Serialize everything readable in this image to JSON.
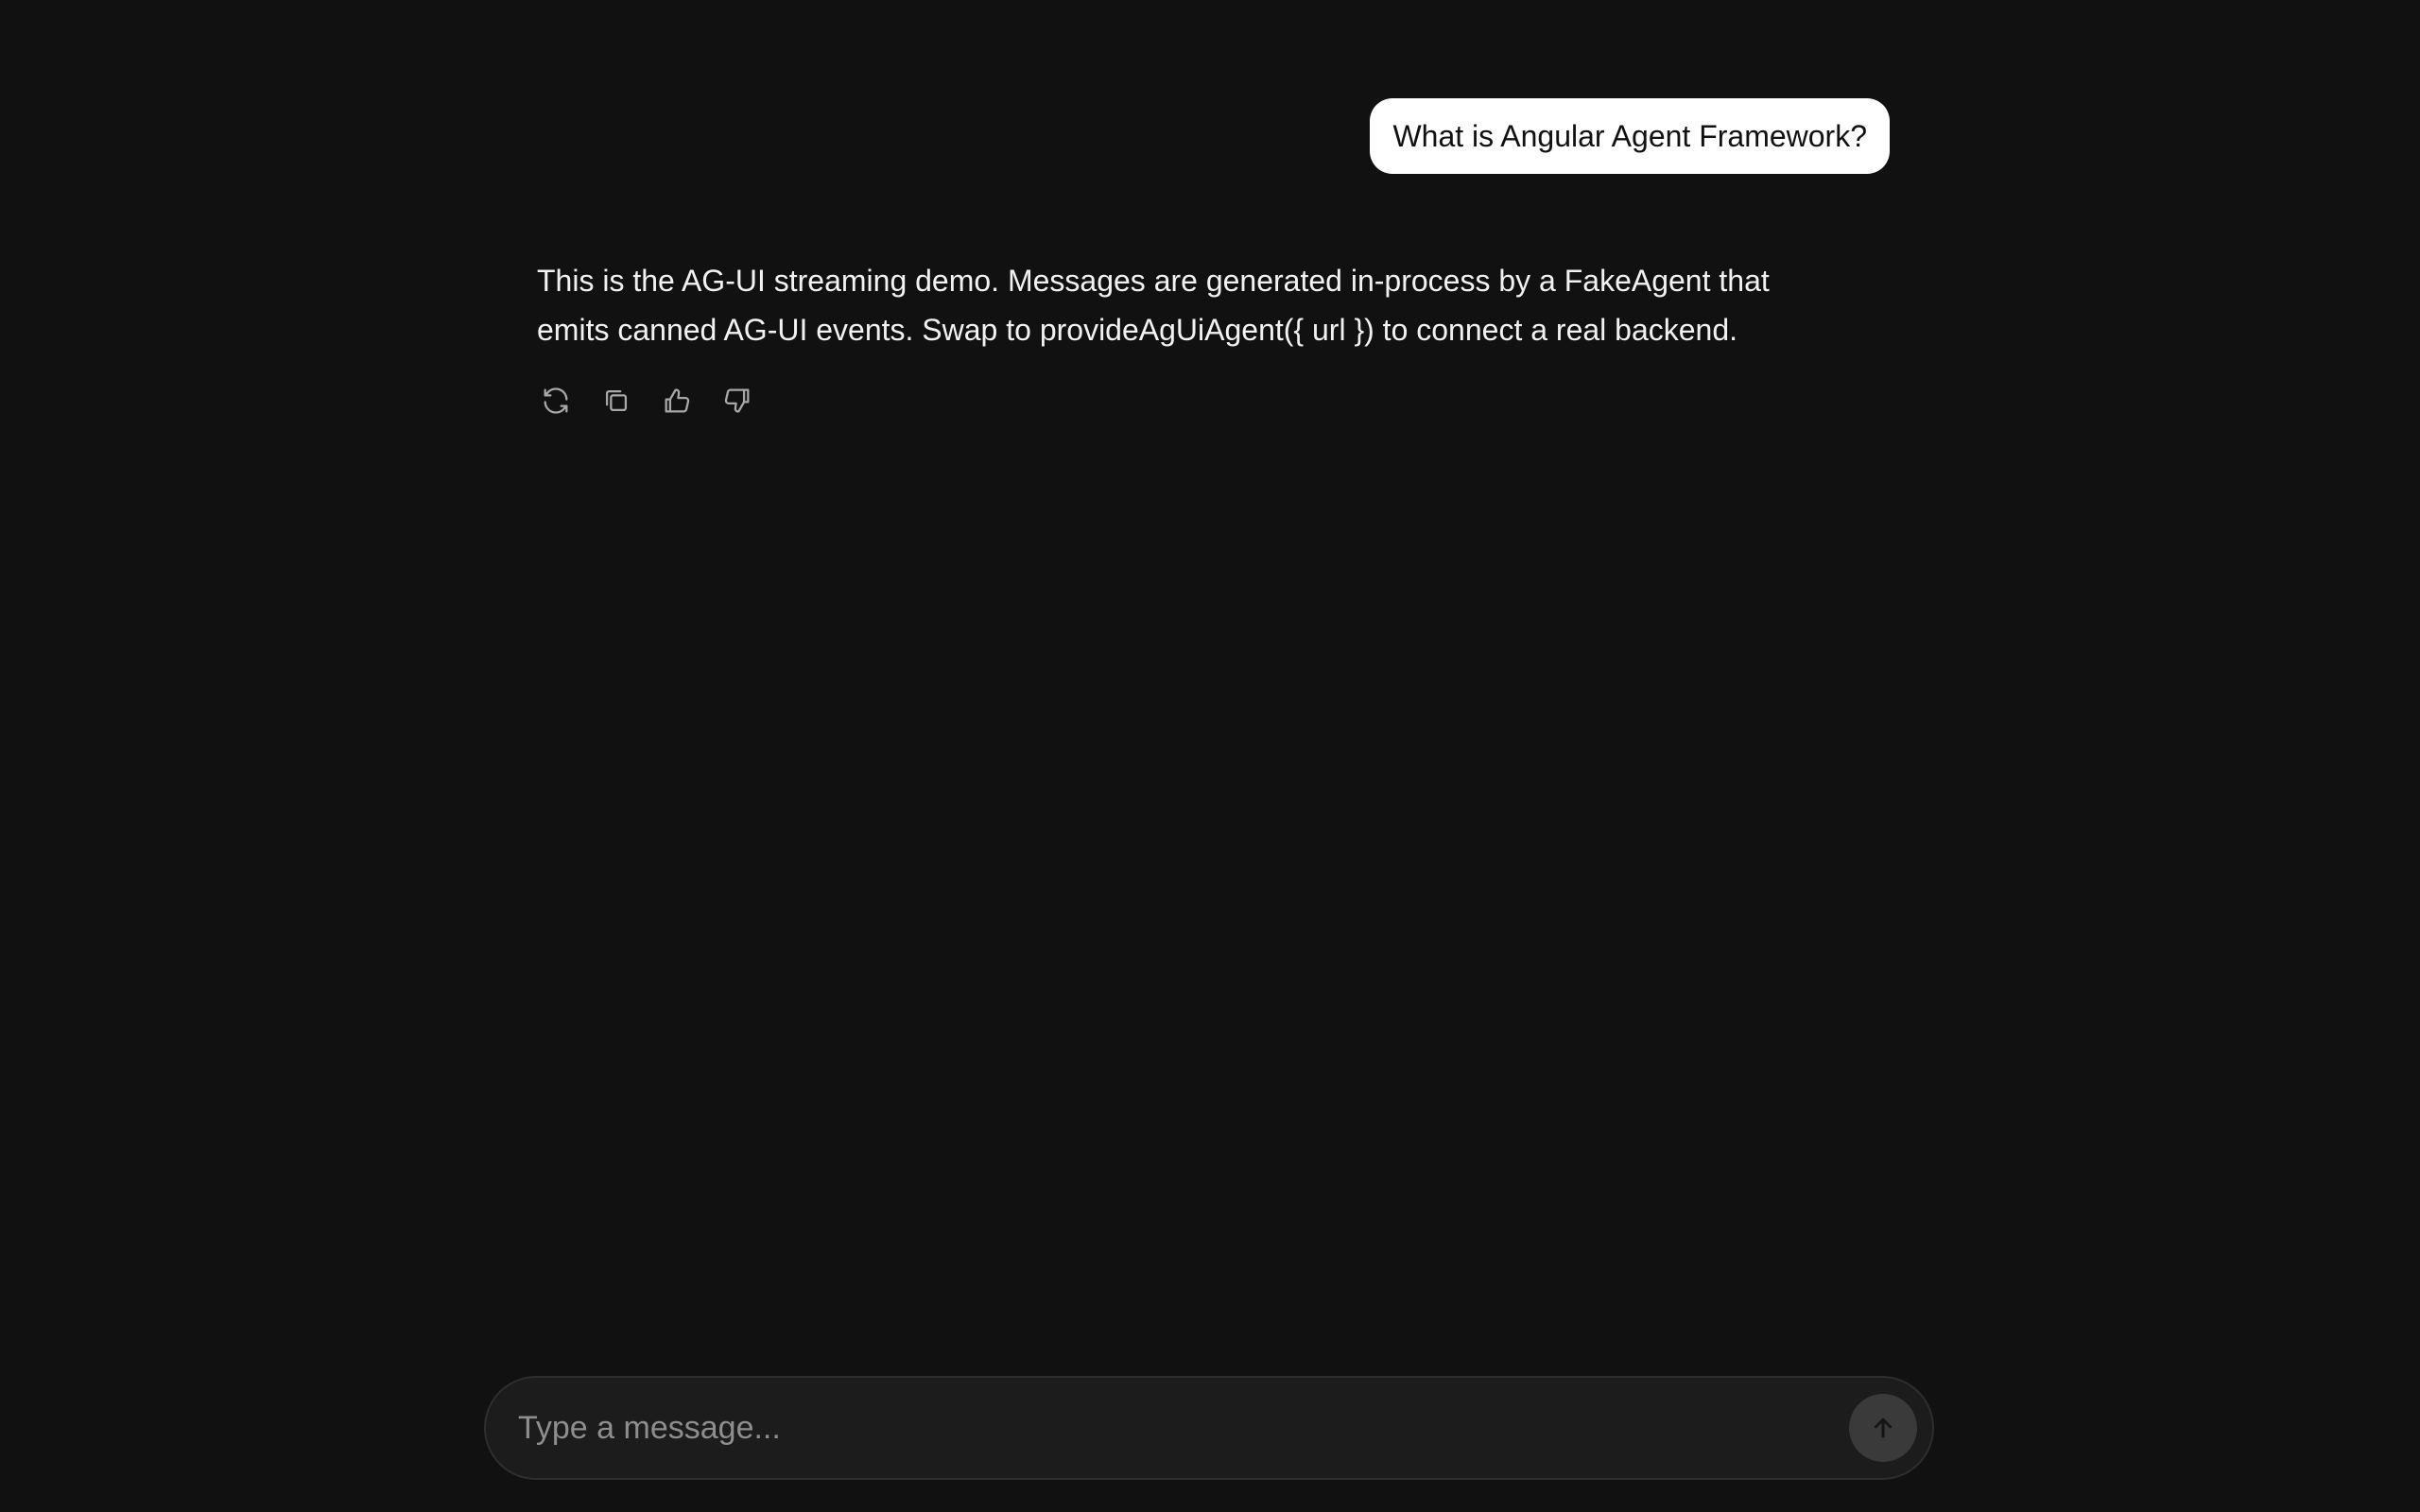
{
  "thread": {
    "user_message": "What is Angular Agent Framework?",
    "assistant_message": "This is the AG-UI streaming demo. Messages are generated in-process by a FakeAgent that emits canned AG-UI events. Swap to provideAgUiAgent({ url }) to connect a real backend.",
    "actions": [
      {
        "icon": "refresh-icon"
      },
      {
        "icon": "copy-icon"
      },
      {
        "icon": "thumbs-up-icon"
      },
      {
        "icon": "thumbs-down-icon"
      }
    ]
  },
  "composer": {
    "placeholder": "Type a message...",
    "value": "",
    "send_icon": "arrow-up-icon"
  },
  "colors": {
    "background": "#111111",
    "user_bubble": "#ffffff",
    "composer": "#1c1c1c",
    "send_button": "#3a3a3a"
  }
}
